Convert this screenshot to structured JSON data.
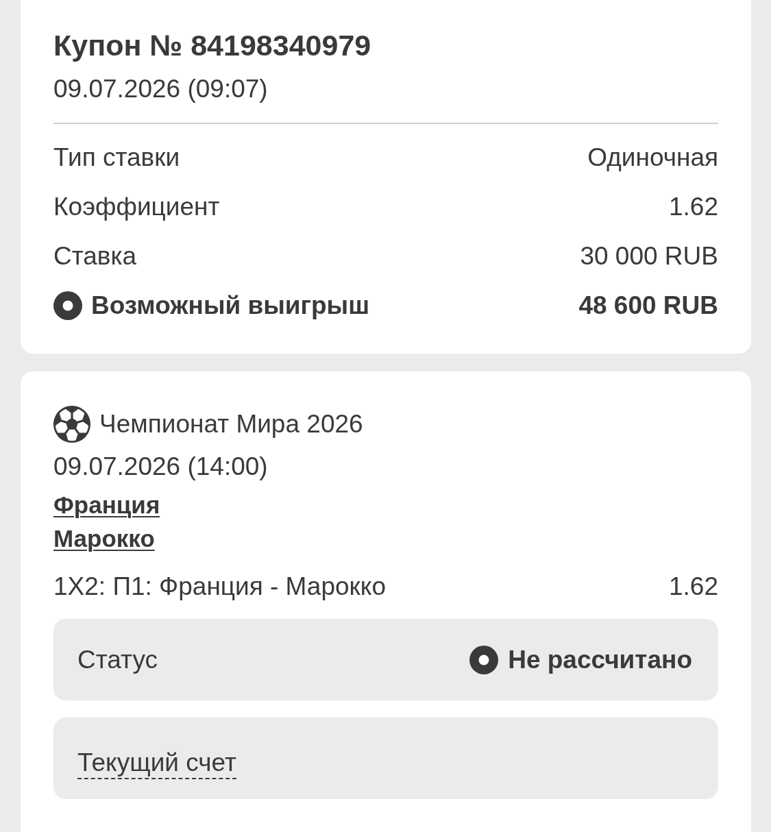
{
  "coupon": {
    "title": "Купон № 84198340979",
    "date": "09.07.2026 (09:07)",
    "rows": [
      {
        "kind": "plain",
        "label": "Тип ставки",
        "value": "Одиночная"
      },
      {
        "kind": "plain",
        "label": "Коэффициент",
        "value": "1.62"
      },
      {
        "kind": "plain",
        "label": "Ставка",
        "value": "30 000 RUB"
      },
      {
        "kind": "highlight",
        "label": "Возможный выигрыш",
        "value": "48 600 RUB"
      }
    ]
  },
  "event": {
    "tournament": "Чемпионат Мира 2026",
    "date": "09.07.2026 (14:00)",
    "teams": [
      "Франция",
      "Марокко"
    ],
    "bet": {
      "label": "1X2: П1: Франция - Марокко",
      "odds": "1.62"
    },
    "status": {
      "label": "Статус",
      "value": "Не рассчитано"
    },
    "score": {
      "label": "Текущий счет"
    }
  }
}
